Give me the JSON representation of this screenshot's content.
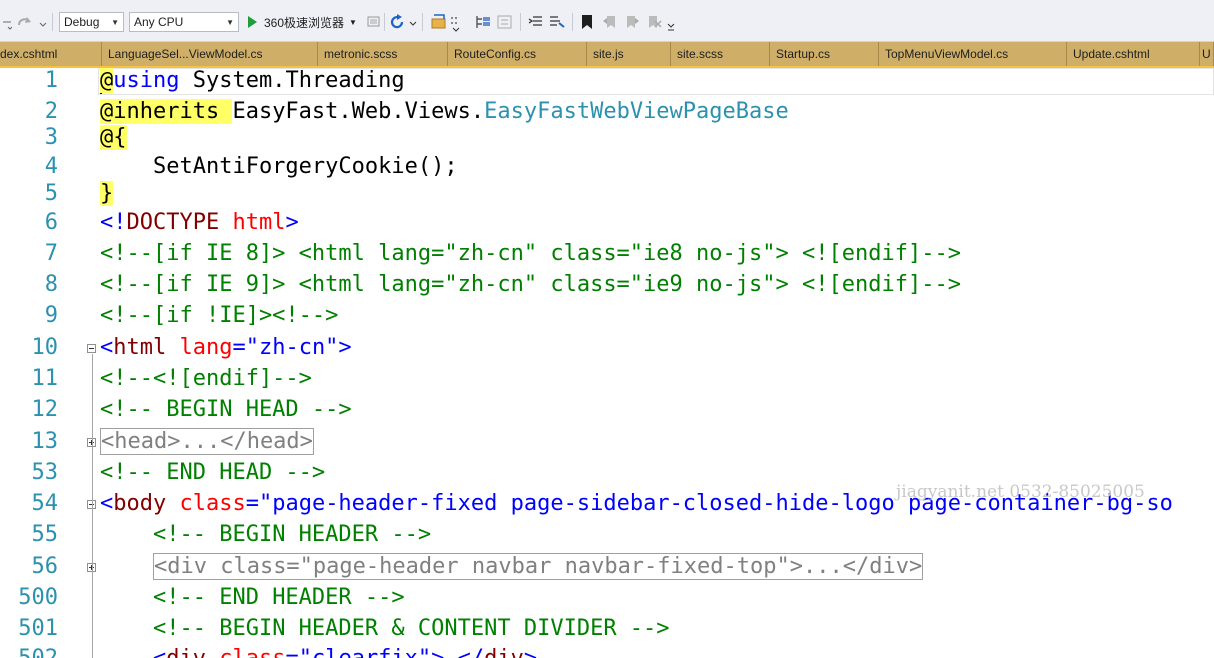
{
  "toolbar": {
    "configuration": "Debug",
    "platform": "Any CPU",
    "run_target": "360极速浏览器"
  },
  "tabs": [
    {
      "label": "dex.cshtml"
    },
    {
      "label": "LanguageSel...ViewModel.cs"
    },
    {
      "label": "metronic.scss"
    },
    {
      "label": "RouteConfig.cs"
    },
    {
      "label": "site.js"
    },
    {
      "label": "site.scss"
    },
    {
      "label": "Startup.cs"
    },
    {
      "label": "TopMenuViewModel.cs"
    },
    {
      "label": "Update.cshtml"
    },
    {
      "label": "U"
    }
  ],
  "lines": [
    {
      "num": "1",
      "segs": [
        {
          "t": "@",
          "c": "razor"
        },
        {
          "t": "using",
          "c": "kw"
        },
        {
          "t": " System.Threading",
          "c": "pl"
        }
      ]
    },
    {
      "num": "2",
      "segs": [
        {
          "t": "@inherits ",
          "c": "razor"
        },
        {
          "t": "EasyFast.Web.Views.",
          "c": "pl"
        },
        {
          "t": "EasyFastWebViewPageBase",
          "c": "tp"
        }
      ]
    },
    {
      "num": "3",
      "segs": [
        {
          "t": "@{",
          "c": "razor"
        }
      ]
    },
    {
      "num": "4",
      "segs": [
        {
          "t": "    SetAntiForgeryCookie();",
          "c": "pl"
        }
      ]
    },
    {
      "num": "5",
      "segs": [
        {
          "t": "}",
          "c": "razor"
        }
      ]
    },
    {
      "num": "6",
      "segs": [
        {
          "t": "<!",
          "c": "bl"
        },
        {
          "t": "DOCTYPE",
          "c": "tag"
        },
        {
          "t": " ",
          "c": "pl"
        },
        {
          "t": "html",
          "c": "attr"
        },
        {
          "t": ">",
          "c": "bl"
        }
      ]
    },
    {
      "num": "7",
      "segs": [
        {
          "t": "<!--[if IE 8]> <html lang=\"zh-cn\" class=\"ie8 no-js\"> <![endif]-->",
          "c": "gr"
        }
      ]
    },
    {
      "num": "8",
      "segs": [
        {
          "t": "<!--[if IE 9]> <html lang=\"zh-cn\" class=\"ie9 no-js\"> <![endif]-->",
          "c": "gr"
        }
      ]
    },
    {
      "num": "9",
      "segs": [
        {
          "t": "<!--[if !IE]><!-->",
          "c": "gr"
        }
      ]
    },
    {
      "num": "10",
      "segs": [
        {
          "t": "<",
          "c": "bl"
        },
        {
          "t": "html",
          "c": "tag"
        },
        {
          "t": " ",
          "c": "pl"
        },
        {
          "t": "lang",
          "c": "attr"
        },
        {
          "t": "=\"zh-cn\">",
          "c": "bl"
        }
      ]
    },
    {
      "num": "11",
      "segs": [
        {
          "t": "<!--<![endif]-->",
          "c": "gr"
        }
      ]
    },
    {
      "num": "12",
      "segs": [
        {
          "t": "<!-- BEGIN HEAD -->",
          "c": "gr"
        }
      ]
    },
    {
      "num": "13",
      "segs": [
        {
          "t": "<head>...</head>",
          "c": "gray collapsed"
        }
      ]
    },
    {
      "num": "53",
      "segs": [
        {
          "t": "<!-- END HEAD -->",
          "c": "gr"
        }
      ]
    },
    {
      "num": "54",
      "segs": [
        {
          "t": "<",
          "c": "bl"
        },
        {
          "t": "body",
          "c": "tag"
        },
        {
          "t": " ",
          "c": "pl"
        },
        {
          "t": "class",
          "c": "attr"
        },
        {
          "t": "=\"page-header-fixed page-sidebar-closed-hide-logo page-container-bg-so",
          "c": "bl"
        }
      ]
    },
    {
      "num": "55",
      "segs": [
        {
          "t": "    ",
          "c": "pl"
        },
        {
          "t": "<!-- BEGIN HEADER -->",
          "c": "gr"
        }
      ]
    },
    {
      "num": "56",
      "segs": [
        {
          "t": "    ",
          "c": "pl"
        },
        {
          "t": "<div class=\"page-header navbar navbar-fixed-top\">...</div>",
          "c": "gray collapsed"
        }
      ]
    },
    {
      "num": "500",
      "segs": [
        {
          "t": "    ",
          "c": "pl"
        },
        {
          "t": "<!-- END HEADER -->",
          "c": "gr"
        }
      ]
    },
    {
      "num": "501",
      "segs": [
        {
          "t": "    ",
          "c": "pl"
        },
        {
          "t": "<!-- BEGIN HEADER & CONTENT DIVIDER -->",
          "c": "gr"
        }
      ]
    },
    {
      "num": "502",
      "segs": [
        {
          "t": "    ",
          "c": "pl"
        },
        {
          "t": "<",
          "c": "bl"
        },
        {
          "t": "div",
          "c": "tag"
        },
        {
          "t": " ",
          "c": "pl"
        },
        {
          "t": "class",
          "c": "attr"
        },
        {
          "t": "=\"clearfix\"> </",
          "c": "bl"
        },
        {
          "t": "div",
          "c": "tag"
        },
        {
          "t": ">",
          "c": "bl"
        }
      ]
    }
  ],
  "watermark": "jiagyanit.net 0532-85025005",
  "colors": {
    "tab_strip": "#c9a760",
    "razor_highlight": "#ffff66",
    "line_number": "#2b91af",
    "keyword": "#0000ff",
    "comment": "#008000"
  }
}
